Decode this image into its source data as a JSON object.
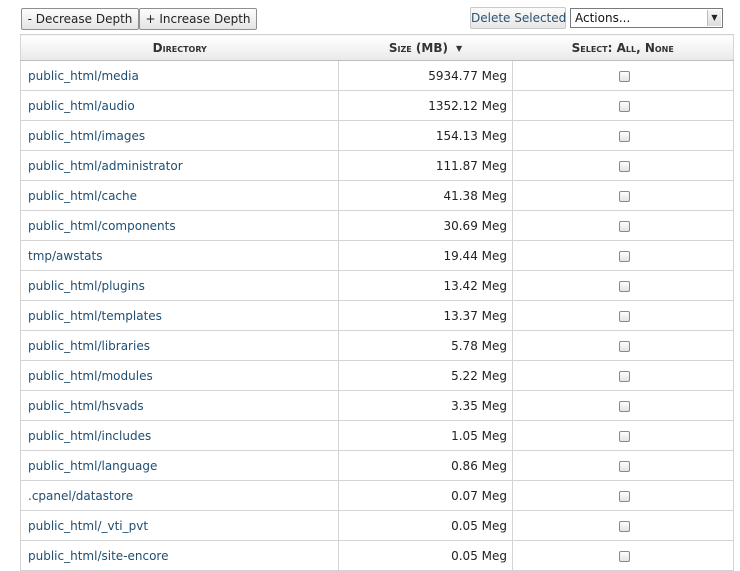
{
  "toolbar": {
    "decrease_label": "- Decrease Depth",
    "increase_label": "+ Increase Depth",
    "delete_label": "Delete Selected",
    "actions_value": "Actions..."
  },
  "table": {
    "headers": {
      "directory": "Directory",
      "size": "Size (MB)",
      "select": "Select: All, None"
    },
    "rows": [
      {
        "directory": "public_html/media",
        "size": "5934.77 Meg"
      },
      {
        "directory": "public_html/audio",
        "size": "1352.12 Meg"
      },
      {
        "directory": "public_html/images",
        "size": "154.13 Meg"
      },
      {
        "directory": "public_html/administrator",
        "size": "111.87 Meg"
      },
      {
        "directory": "public_html/cache",
        "size": "41.38 Meg"
      },
      {
        "directory": "public_html/components",
        "size": "30.69 Meg"
      },
      {
        "directory": "tmp/awstats",
        "size": "19.44 Meg"
      },
      {
        "directory": "public_html/plugins",
        "size": "13.42 Meg"
      },
      {
        "directory": "public_html/templates",
        "size": "13.37 Meg"
      },
      {
        "directory": "public_html/libraries",
        "size": "5.78 Meg"
      },
      {
        "directory": "public_html/modules",
        "size": "5.22 Meg"
      },
      {
        "directory": "public_html/hsvads",
        "size": "3.35 Meg"
      },
      {
        "directory": "public_html/includes",
        "size": "1.05 Meg"
      },
      {
        "directory": "public_html/language",
        "size": "0.86 Meg"
      },
      {
        "directory": ".cpanel/datastore",
        "size": "0.07 Meg"
      },
      {
        "directory": "public_html/_vti_pvt",
        "size": "0.05 Meg"
      },
      {
        "directory": "public_html/site-encore",
        "size": "0.05 Meg"
      }
    ]
  },
  "icons": {
    "sort": "sort-desc-icon",
    "dropdown": "chevron-down-icon"
  },
  "colors": {
    "link": "#1e4e72",
    "border": "#d4d4d4"
  }
}
